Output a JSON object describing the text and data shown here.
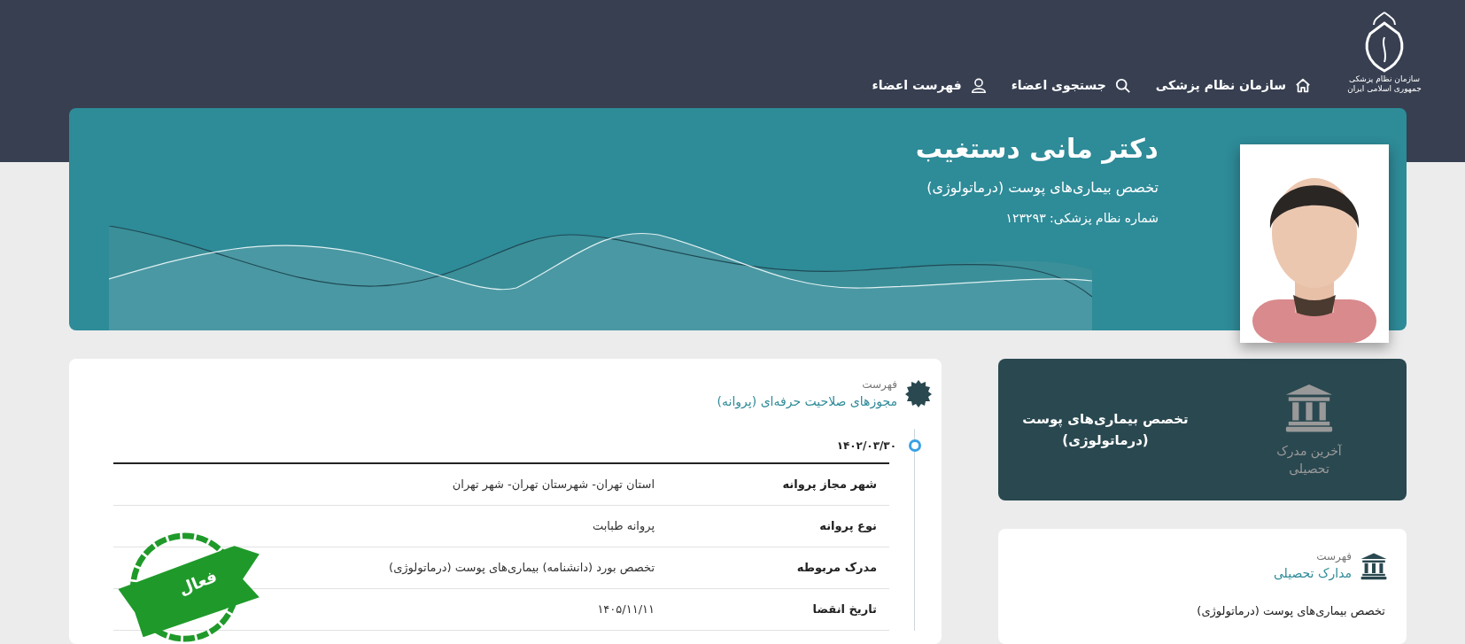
{
  "header": {
    "logo_caption": "سازمان نظام پزشکی جمهوری اسلامی ایران",
    "nav": [
      {
        "kind": "home",
        "label": "سازمان نظام پزشکی"
      },
      {
        "kind": "search",
        "label": "جستجوی اعضاء"
      },
      {
        "kind": "user",
        "label": "فهرست اعضاء"
      }
    ]
  },
  "profile": {
    "name": "دکتر مانی دستغیب",
    "specialty": "تخصص بیماری‌های پوست (درماتولوژی)",
    "license_number": "شماره نظام پزشکی: ۱۲۳۲۹۳"
  },
  "latest_degree": {
    "label": "آخرین مدرک تحصیلی",
    "title": "تخصص بیماری‌های پوست (درماتولوژی)"
  },
  "licenses": {
    "caption": "فهرست",
    "title": "مجوزهای صلاحیت حرفه‌ای (پروانه)",
    "date": "۱۴۰۲/۰۳/۳۰",
    "stamp": "فعال",
    "rows": [
      {
        "label": "شهر مجاز پروانه",
        "value": "استان تهران- شهرستان تهران- شهر تهران"
      },
      {
        "label": "نوع پروانه",
        "value": "پروانه طبابت"
      },
      {
        "label": "مدرک مربوطه",
        "value": "تخصص بورد (دانشنامه) بیماری‌های پوست (درماتولوژی)"
      },
      {
        "label": "تاریخ انقضا",
        "value": "۱۴۰۵/۱۱/۱۱"
      }
    ]
  },
  "degrees": {
    "caption": "فهرست",
    "title": "مدارک تحصیلی",
    "items": [
      "تخصص بیماری‌های پوست (درماتولوژی)"
    ]
  }
}
